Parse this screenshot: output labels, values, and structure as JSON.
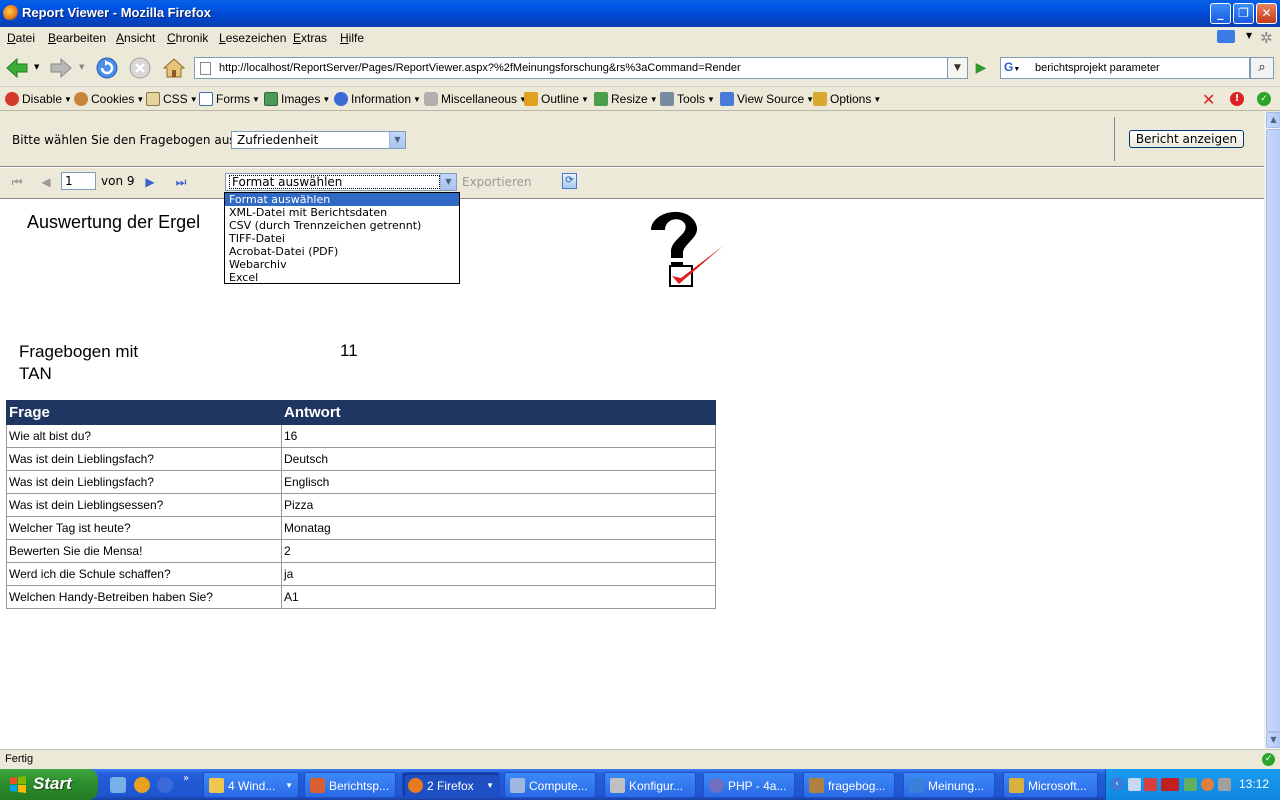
{
  "window": {
    "title": "Report Viewer - Mozilla Firefox"
  },
  "menu": [
    "Datei",
    "Bearbeiten",
    "Ansicht",
    "Chronik",
    "Lesezeichen",
    "Extras",
    "Hilfe"
  ],
  "nav": {
    "url": "http://localhost/ReportServer/Pages/ReportViewer.aspx?%2fMeinungsforschung&rs%3aCommand=Render",
    "search_engine": "G",
    "search_query": "berichtsprojekt parameter"
  },
  "devtoolbar": [
    "Disable",
    "Cookies",
    "CSS",
    "Forms",
    "Images",
    "Information",
    "Miscellaneous",
    "Outline",
    "Resize",
    "Tools",
    "View Source",
    "Options"
  ],
  "params": {
    "label": "Bitte wählen Sie den Fragebogen aus",
    "selected": "Zufriedenheit",
    "show_button": "Bericht anzeigen"
  },
  "report_toolbar": {
    "page": "1",
    "of_text": "von 9",
    "format_selected": "Format auswählen",
    "export_label": "Exportieren",
    "format_options": [
      "Format auswählen",
      "XML-Datei mit Berichtsdaten",
      "CSV (durch Trennzeichen getrennt)",
      "TIFF-Datei",
      "Acrobat-Datei (PDF)",
      "Webarchiv",
      "Excel"
    ]
  },
  "report": {
    "title": "Auswertung der Ergel",
    "tan_label": "Fragebogen mit TAN",
    "tan_value": "11",
    "columns": [
      "Frage",
      "Antwort"
    ],
    "rows": [
      [
        "Wie alt bist du?",
        "16"
      ],
      [
        "Was ist dein Lieblingsfach?",
        "Deutsch"
      ],
      [
        "Was ist dein Lieblingsfach?",
        "Englisch"
      ],
      [
        "Was ist dein Lieblingsessen?",
        "Pizza"
      ],
      [
        "Welcher Tag ist heute?",
        "Monatag"
      ],
      [
        "Bewerten Sie die Mensa!",
        "2"
      ],
      [
        "Werd ich die Schule schaffen?",
        "ja"
      ],
      [
        "Welchen Handy-Betreiben haben Sie?",
        "A1"
      ]
    ]
  },
  "status": {
    "text": "Fertig"
  },
  "taskbar": {
    "start": "Start",
    "tasks": [
      "4 Wind...",
      "Berichtsp...",
      "2 Firefox",
      "Compute...",
      "Konfigur...",
      "PHP - 4a...",
      "fragebog...",
      "Meinung...",
      "Microsoft..."
    ],
    "clock": "13:12"
  },
  "colors": {
    "table_header": "#1f3562",
    "selection": "#316ac5",
    "titlebar": "#0058e6"
  }
}
